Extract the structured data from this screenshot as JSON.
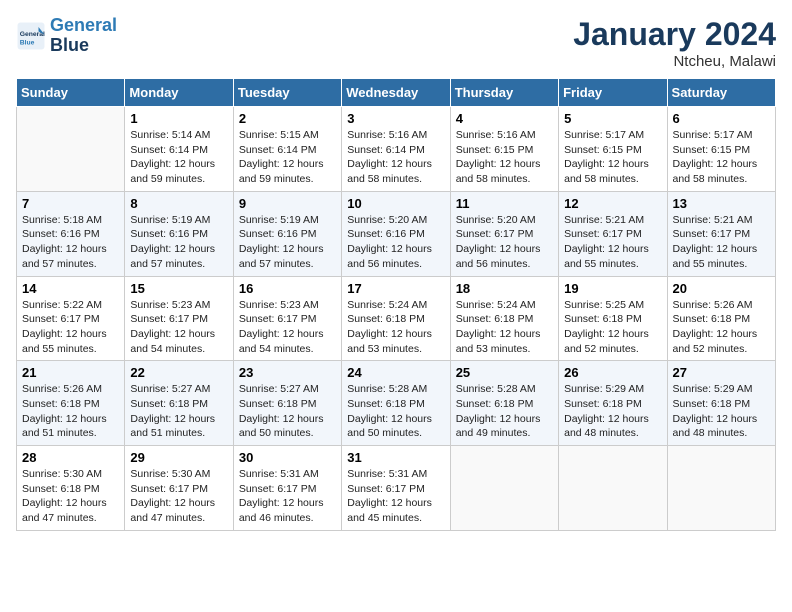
{
  "logo": {
    "line1": "General",
    "line2": "Blue"
  },
  "title": "January 2024",
  "location": "Ntcheu, Malawi",
  "weekdays": [
    "Sunday",
    "Monday",
    "Tuesday",
    "Wednesday",
    "Thursday",
    "Friday",
    "Saturday"
  ],
  "weeks": [
    [
      {
        "empty": true
      },
      {
        "day": "1",
        "sunrise": "5:14 AM",
        "sunset": "6:14 PM",
        "daylight": "12 hours and 59 minutes."
      },
      {
        "day": "2",
        "sunrise": "5:15 AM",
        "sunset": "6:14 PM",
        "daylight": "12 hours and 59 minutes."
      },
      {
        "day": "3",
        "sunrise": "5:16 AM",
        "sunset": "6:14 PM",
        "daylight": "12 hours and 58 minutes."
      },
      {
        "day": "4",
        "sunrise": "5:16 AM",
        "sunset": "6:15 PM",
        "daylight": "12 hours and 58 minutes."
      },
      {
        "day": "5",
        "sunrise": "5:17 AM",
        "sunset": "6:15 PM",
        "daylight": "12 hours and 58 minutes."
      },
      {
        "day": "6",
        "sunrise": "5:17 AM",
        "sunset": "6:15 PM",
        "daylight": "12 hours and 58 minutes."
      }
    ],
    [
      {
        "day": "7",
        "sunrise": "5:18 AM",
        "sunset": "6:16 PM",
        "daylight": "12 hours and 57 minutes."
      },
      {
        "day": "8",
        "sunrise": "5:19 AM",
        "sunset": "6:16 PM",
        "daylight": "12 hours and 57 minutes."
      },
      {
        "day": "9",
        "sunrise": "5:19 AM",
        "sunset": "6:16 PM",
        "daylight": "12 hours and 57 minutes."
      },
      {
        "day": "10",
        "sunrise": "5:20 AM",
        "sunset": "6:16 PM",
        "daylight": "12 hours and 56 minutes."
      },
      {
        "day": "11",
        "sunrise": "5:20 AM",
        "sunset": "6:17 PM",
        "daylight": "12 hours and 56 minutes."
      },
      {
        "day": "12",
        "sunrise": "5:21 AM",
        "sunset": "6:17 PM",
        "daylight": "12 hours and 55 minutes."
      },
      {
        "day": "13",
        "sunrise": "5:21 AM",
        "sunset": "6:17 PM",
        "daylight": "12 hours and 55 minutes."
      }
    ],
    [
      {
        "day": "14",
        "sunrise": "5:22 AM",
        "sunset": "6:17 PM",
        "daylight": "12 hours and 55 minutes."
      },
      {
        "day": "15",
        "sunrise": "5:23 AM",
        "sunset": "6:17 PM",
        "daylight": "12 hours and 54 minutes."
      },
      {
        "day": "16",
        "sunrise": "5:23 AM",
        "sunset": "6:17 PM",
        "daylight": "12 hours and 54 minutes."
      },
      {
        "day": "17",
        "sunrise": "5:24 AM",
        "sunset": "6:18 PM",
        "daylight": "12 hours and 53 minutes."
      },
      {
        "day": "18",
        "sunrise": "5:24 AM",
        "sunset": "6:18 PM",
        "daylight": "12 hours and 53 minutes."
      },
      {
        "day": "19",
        "sunrise": "5:25 AM",
        "sunset": "6:18 PM",
        "daylight": "12 hours and 52 minutes."
      },
      {
        "day": "20",
        "sunrise": "5:26 AM",
        "sunset": "6:18 PM",
        "daylight": "12 hours and 52 minutes."
      }
    ],
    [
      {
        "day": "21",
        "sunrise": "5:26 AM",
        "sunset": "6:18 PM",
        "daylight": "12 hours and 51 minutes."
      },
      {
        "day": "22",
        "sunrise": "5:27 AM",
        "sunset": "6:18 PM",
        "daylight": "12 hours and 51 minutes."
      },
      {
        "day": "23",
        "sunrise": "5:27 AM",
        "sunset": "6:18 PM",
        "daylight": "12 hours and 50 minutes."
      },
      {
        "day": "24",
        "sunrise": "5:28 AM",
        "sunset": "6:18 PM",
        "daylight": "12 hours and 50 minutes."
      },
      {
        "day": "25",
        "sunrise": "5:28 AM",
        "sunset": "6:18 PM",
        "daylight": "12 hours and 49 minutes."
      },
      {
        "day": "26",
        "sunrise": "5:29 AM",
        "sunset": "6:18 PM",
        "daylight": "12 hours and 48 minutes."
      },
      {
        "day": "27",
        "sunrise": "5:29 AM",
        "sunset": "6:18 PM",
        "daylight": "12 hours and 48 minutes."
      }
    ],
    [
      {
        "day": "28",
        "sunrise": "5:30 AM",
        "sunset": "6:18 PM",
        "daylight": "12 hours and 47 minutes."
      },
      {
        "day": "29",
        "sunrise": "5:30 AM",
        "sunset": "6:17 PM",
        "daylight": "12 hours and 47 minutes."
      },
      {
        "day": "30",
        "sunrise": "5:31 AM",
        "sunset": "6:17 PM",
        "daylight": "12 hours and 46 minutes."
      },
      {
        "day": "31",
        "sunrise": "5:31 AM",
        "sunset": "6:17 PM",
        "daylight": "12 hours and 45 minutes."
      },
      {
        "empty": true
      },
      {
        "empty": true
      },
      {
        "empty": true
      }
    ]
  ],
  "labels": {
    "sunrise": "Sunrise:",
    "sunset": "Sunset:",
    "daylight": "Daylight:"
  }
}
